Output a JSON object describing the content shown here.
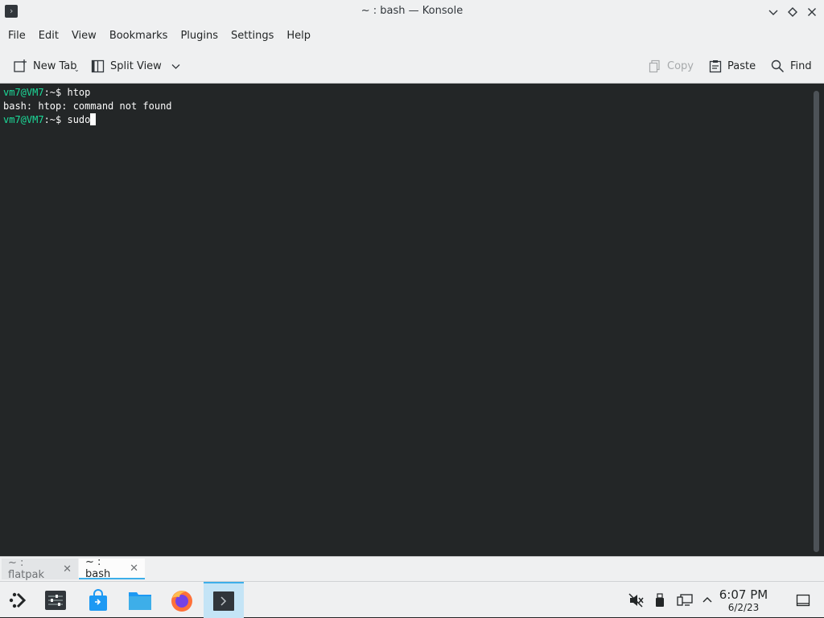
{
  "window": {
    "title": "~ : bash — Konsole"
  },
  "menu": [
    "File",
    "Edit",
    "View",
    "Bookmarks",
    "Plugins",
    "Settings",
    "Help"
  ],
  "toolbar": {
    "new_tab": "New Tab",
    "split_view": "Split View",
    "copy": "Copy",
    "paste": "Paste",
    "find": "Find"
  },
  "terminal": {
    "line1_prompt": "vm7@VM7",
    "line1_path": ":~$ ",
    "line1_cmd": "htop",
    "line2": "bash: htop: command not found",
    "line3_prompt": "vm7@VM7",
    "line3_path": ":~$ ",
    "line3_cmd": "sudo"
  },
  "tabs": [
    {
      "label": "~ : flatpak"
    },
    {
      "label": "~ : bash"
    }
  ],
  "clock": {
    "time": "6:07 PM",
    "date": "6/2/23"
  },
  "colors": {
    "accent": "#3daee9",
    "prompt": "#1cdc9a",
    "terminal_bg": "#232627"
  }
}
